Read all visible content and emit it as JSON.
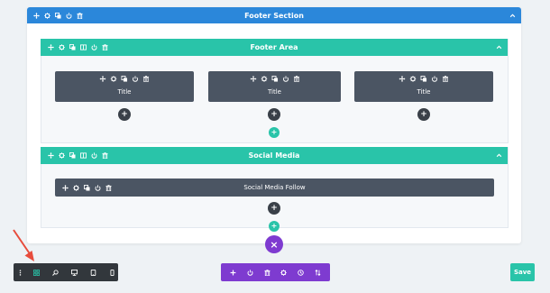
{
  "section": {
    "title": "Footer Section"
  },
  "rows": [
    {
      "title": "Footer Area",
      "modules": [
        {
          "title": "Title"
        },
        {
          "title": "Title"
        },
        {
          "title": "Title"
        }
      ]
    },
    {
      "title": "Social Media",
      "modules": [
        {
          "title": "Social Media Follow"
        }
      ]
    }
  ],
  "buttons": {
    "add": "+",
    "close": "×",
    "save": "Save"
  },
  "colors": {
    "section": "#2b87da",
    "row": "#29c4a9",
    "module": "#4b5563",
    "builder": "#7e3bd0",
    "toolbar": "#32373c",
    "annotation_arrow": "#e74c3c"
  },
  "icons": {
    "section": [
      "move-icon",
      "gear-icon",
      "duplicate-icon",
      "power-icon",
      "trash-icon"
    ],
    "row": [
      "move-icon",
      "gear-icon",
      "duplicate-icon",
      "columns-icon",
      "power-icon",
      "trash-icon"
    ],
    "module": [
      "move-icon",
      "gear-icon",
      "duplicate-icon",
      "power-icon",
      "trash-icon"
    ],
    "left_toolbar": [
      "more-options-icon",
      "wireframe-view-icon",
      "zoom-icon",
      "desktop-view-icon",
      "tablet-view-icon",
      "phone-view-icon"
    ],
    "builder_toolbar": [
      "add-icon",
      "power-icon",
      "trash-icon",
      "gear-icon",
      "history-icon",
      "sort-icon"
    ]
  }
}
